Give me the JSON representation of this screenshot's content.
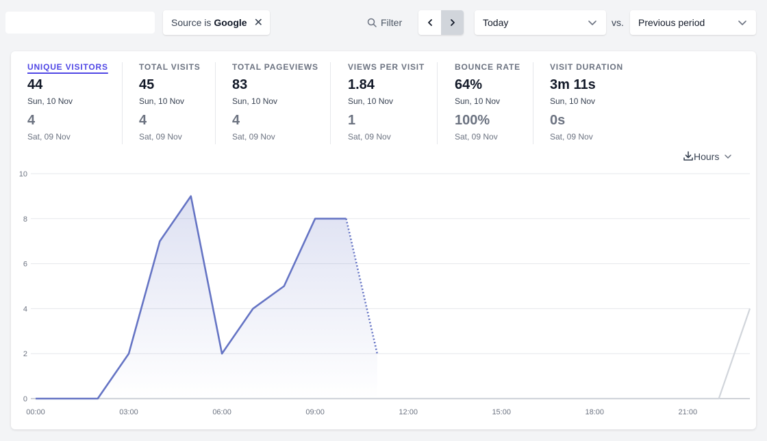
{
  "filter_bar": {
    "filter_pill": {
      "prefix": "Source is",
      "value": "Google"
    },
    "filter_button_label": "Filter",
    "period_select": "Today",
    "vs_label": "vs.",
    "comparison_select": "Previous period"
  },
  "metrics": [
    {
      "label": "Unique visitors",
      "value": "44",
      "date": "Sun, 10 Nov",
      "prev_value": "4",
      "prev_date": "Sat, 09 Nov"
    },
    {
      "label": "Total visits",
      "value": "45",
      "date": "Sun, 10 Nov",
      "prev_value": "4",
      "prev_date": "Sat, 09 Nov"
    },
    {
      "label": "Total pageviews",
      "value": "83",
      "date": "Sun, 10 Nov",
      "prev_value": "4",
      "prev_date": "Sat, 09 Nov"
    },
    {
      "label": "Views per visit",
      "value": "1.84",
      "date": "Sun, 10 Nov",
      "prev_value": "1",
      "prev_date": "Sat, 09 Nov"
    },
    {
      "label": "Bounce rate",
      "value": "64%",
      "date": "Sun, 10 Nov",
      "prev_value": "100%",
      "prev_date": "Sat, 09 Nov"
    },
    {
      "label": "Visit duration",
      "value": "3m 11s",
      "date": "Sun, 10 Nov",
      "prev_value": "0s",
      "prev_date": "Sat, 09 Nov"
    }
  ],
  "interval_label": "Hours",
  "colors": {
    "accent": "#4f46e5",
    "series_main": "#6574c4",
    "series_prev": "#d1d5db"
  },
  "chart_data": {
    "type": "line",
    "x_ticks": [
      "00:00",
      "03:00",
      "06:00",
      "09:00",
      "12:00",
      "15:00",
      "18:00",
      "21:00"
    ],
    "y_ticks": [
      "0",
      "2",
      "4",
      "6",
      "8",
      "10"
    ],
    "ylim": [
      0,
      10
    ],
    "x_hours": [
      0,
      23
    ],
    "series": [
      {
        "key": "current",
        "x": [
          0,
          1,
          2,
          3,
          4,
          5,
          6,
          7,
          8,
          9,
          10,
          11
        ],
        "values": [
          0,
          0,
          0,
          2,
          7,
          9,
          2,
          4,
          5,
          8,
          8,
          2
        ],
        "dotted_from_index": 10
      },
      {
        "key": "previous",
        "x": [
          0,
          1,
          2,
          3,
          4,
          5,
          6,
          7,
          8,
          9,
          10,
          11,
          12,
          13,
          14,
          15,
          16,
          17,
          18,
          19,
          20,
          21,
          22,
          23
        ],
        "values": [
          0,
          0,
          0,
          0,
          0,
          0,
          0,
          0,
          0,
          0,
          0,
          0,
          0,
          0,
          0,
          0,
          0,
          0,
          0,
          0,
          0,
          0,
          0,
          4
        ]
      }
    ],
    "grid": true
  }
}
